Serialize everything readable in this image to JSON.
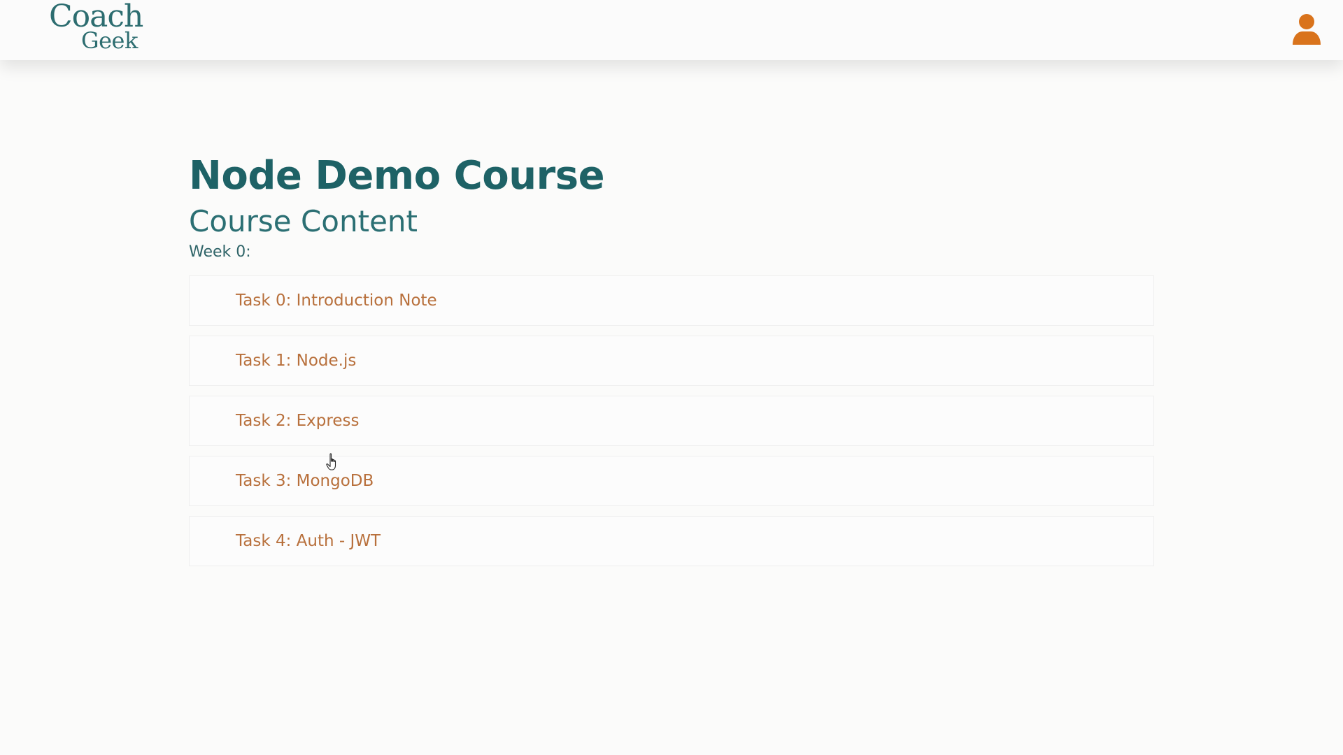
{
  "header": {
    "logo_line1": "Coach",
    "logo_line2": "Geek",
    "logo_color": "#2d6d70",
    "user_icon": "user-icon",
    "user_icon_color": "#d9731c"
  },
  "main": {
    "course_title": "Node Demo Course",
    "section_title": "Course Content",
    "week_label": "Week 0:",
    "tasks": [
      {
        "label": "Task 0: Introduction Note"
      },
      {
        "label": "Task 1: Node.js"
      },
      {
        "label": "Task 2: Express"
      },
      {
        "label": "Task 3: MongoDB"
      },
      {
        "label": "Task 4: Auth - JWT"
      }
    ]
  },
  "colors": {
    "title": "#1e6266",
    "task_text": "#b8703c",
    "background": "#fbfbfa"
  },
  "cursor": {
    "icon": "hand-pointer-icon"
  }
}
